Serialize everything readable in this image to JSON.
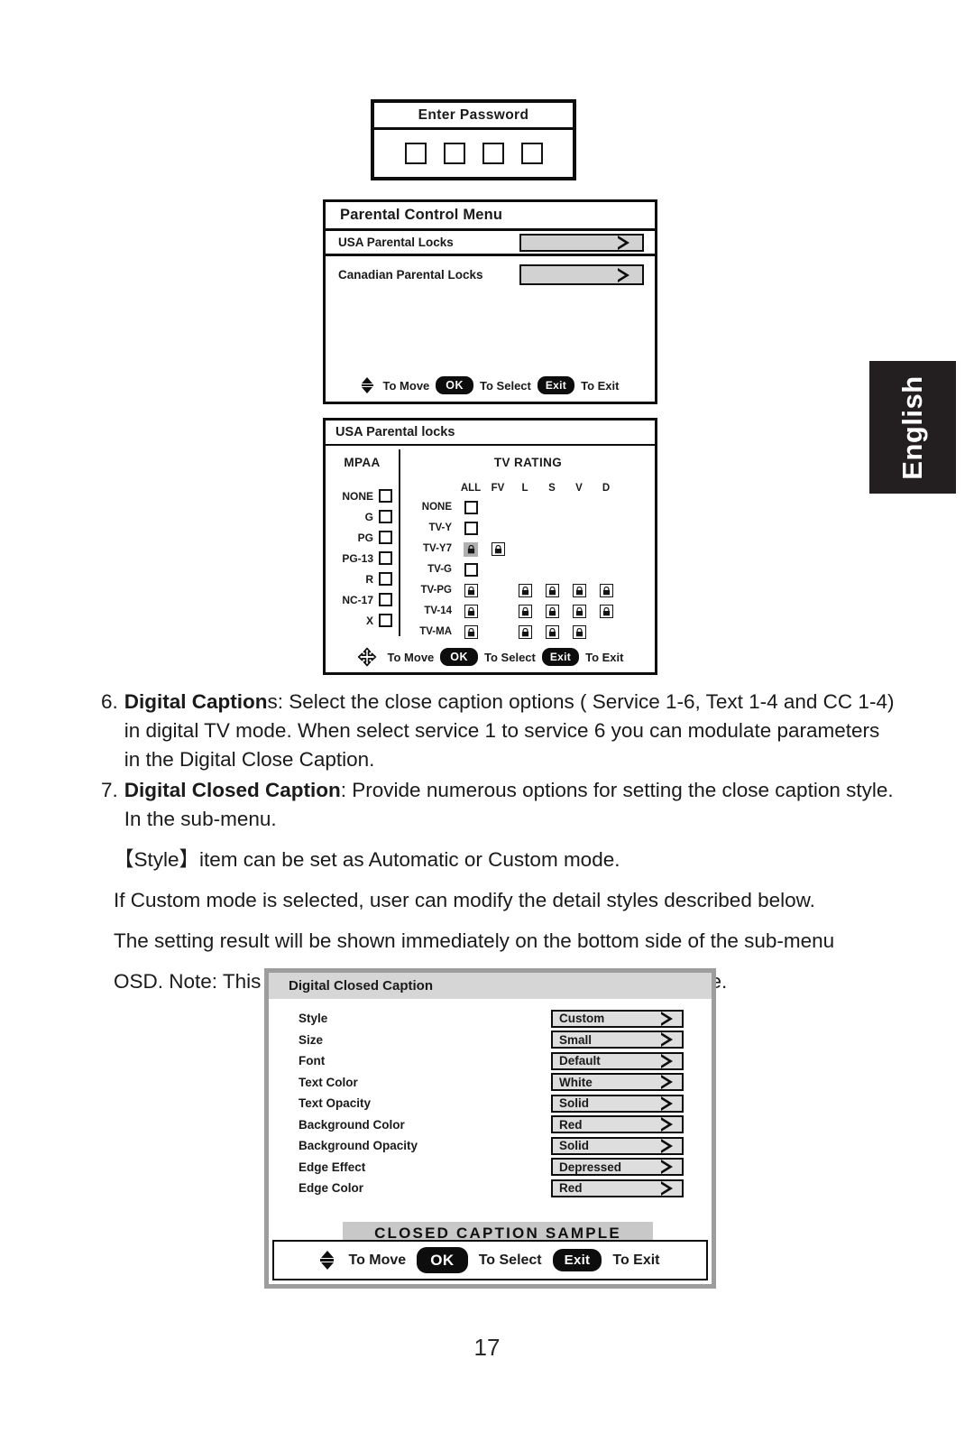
{
  "side_tab": {
    "label": "English"
  },
  "password_dialog": {
    "title": "Enter  Password",
    "box_count": 4
  },
  "parental_control_menu": {
    "title": "Parental Control Menu",
    "rows": [
      {
        "label": "USA Parental Locks",
        "icon": "chevron-right-icon"
      },
      {
        "label": "Canadian Parental Locks",
        "icon": "chevron-right-icon"
      }
    ],
    "hints": {
      "move_icon": "up-down-arrows-icon",
      "move": "To Move",
      "ok": "OK",
      "select": "To Select",
      "exit_btn": "Exit",
      "exit": "To Exit"
    }
  },
  "usa_parental_locks": {
    "title": "USA Parental locks",
    "mpaa": {
      "heading": "MPAA",
      "rows": [
        {
          "label": "NONE",
          "checked": false
        },
        {
          "label": "G",
          "checked": false
        },
        {
          "label": "PG",
          "checked": false
        },
        {
          "label": "PG-13",
          "checked": false
        },
        {
          "label": "R",
          "checked": false
        },
        {
          "label": "NC-17",
          "checked": false
        },
        {
          "label": "X",
          "checked": false
        }
      ]
    },
    "tv_rating": {
      "heading": "TV RATING",
      "columns": [
        "ALL",
        "FV",
        "L",
        "S",
        "V",
        "D"
      ],
      "rows": [
        {
          "label": "NONE",
          "cells": [
            "box",
            "",
            "",
            "",
            "",
            ""
          ]
        },
        {
          "label": "TV-Y",
          "cells": [
            "box",
            "",
            "",
            "",
            "",
            ""
          ]
        },
        {
          "label": "TV-Y7",
          "cells": [
            "lock-selected",
            "lock",
            "",
            "",
            "",
            ""
          ]
        },
        {
          "label": "TV-G",
          "cells": [
            "box",
            "",
            "",
            "",
            "",
            ""
          ]
        },
        {
          "label": "TV-PG",
          "cells": [
            "lock",
            "",
            "lock",
            "lock",
            "lock",
            "lock"
          ]
        },
        {
          "label": "TV-14",
          "cells": [
            "lock",
            "",
            "lock",
            "lock",
            "lock",
            "lock"
          ]
        },
        {
          "label": "TV-MA",
          "cells": [
            "lock",
            "",
            "lock",
            "lock",
            "lock",
            ""
          ]
        }
      ]
    },
    "hints": {
      "move_icon": "four-way-arrows-icon",
      "move": "To Move",
      "ok": "OK",
      "select": "To Select",
      "exit_btn": "Exit",
      "exit": "To Exit"
    }
  },
  "body": {
    "item6": {
      "num": "6.",
      "bold": "Digital Caption",
      "rest": "s: Select the close caption options ( Service 1-6, Text 1-4 and CC 1-4)  in digital TV mode. When select service 1 to service 6 you can modulate parameters in the Digital Close Caption."
    },
    "item7": {
      "num": "7.",
      "bold": "Digital Closed Caption",
      "rest": ": Provide numerous options for setting the close caption style. In the sub-menu."
    },
    "line_style": "【Style】item can be set as Automatic or Custom mode.",
    "line_custom": "If Custom mode is selected, user can modify the detail styles described below.",
    "line_result": "The setting result will be shown immediately on the bottom side of the sub-menu",
    "line_note": "OSD. Note: This feature is only available in Digital TV (ATSC) mode."
  },
  "digital_closed_caption": {
    "title": "Digital Closed Caption",
    "rows": [
      {
        "label": "Style",
        "value": "Custom"
      },
      {
        "label": "Size",
        "value": "Small"
      },
      {
        "label": "Font",
        "value": "Default"
      },
      {
        "label": "Text Color",
        "value": "White"
      },
      {
        "label": "Text Opacity",
        "value": "Solid"
      },
      {
        "label": "Background Color",
        "value": "Red"
      },
      {
        "label": "Background Opacity",
        "value": "Solid"
      },
      {
        "label": "Edge Effect",
        "value": "Depressed"
      },
      {
        "label": "Edge Color",
        "value": "Red"
      }
    ],
    "sample_text": "CLOSED CAPTION SAMPLE",
    "hints": {
      "move_icon": "up-down-arrows-icon",
      "move": "To Move",
      "ok": "OK",
      "select": "To Select",
      "exit_btn": "Exit",
      "exit": "To Exit"
    }
  },
  "page_number": "17"
}
